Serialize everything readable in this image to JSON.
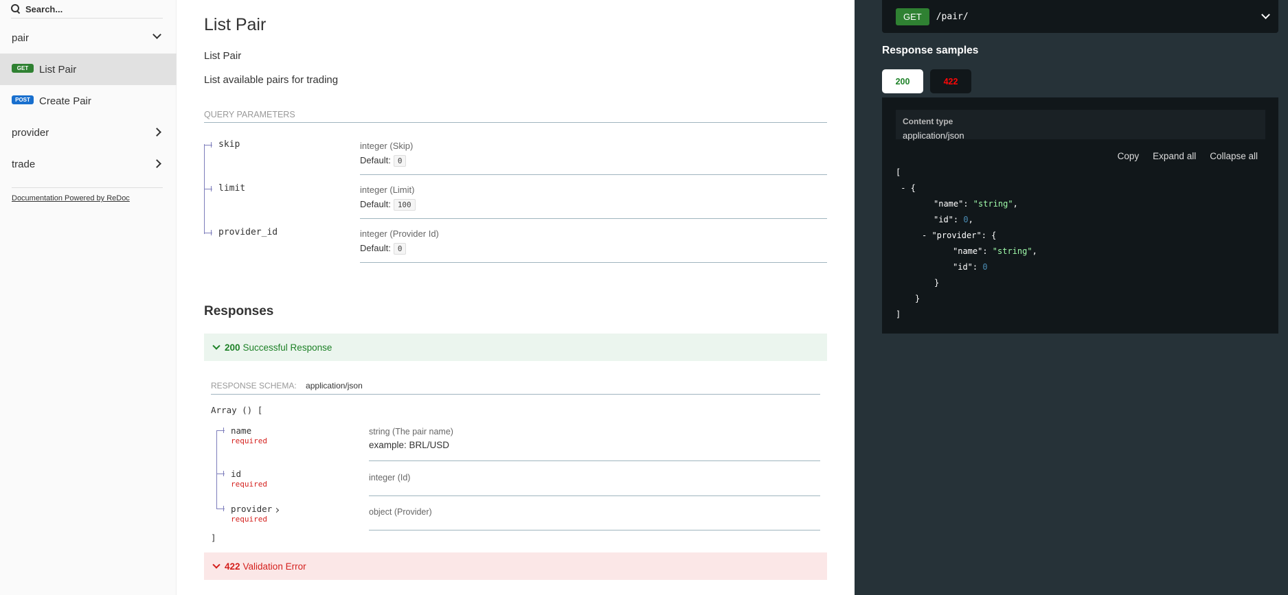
{
  "sidebar": {
    "search_placeholder": "Search...",
    "groups": [
      {
        "label": "pair"
      },
      {
        "label": "provider"
      },
      {
        "label": "trade"
      }
    ],
    "items": [
      {
        "method": "GET",
        "label": "List Pair"
      },
      {
        "method": "POST",
        "label": "Create Pair"
      }
    ],
    "powered_by": "Documentation Powered by ReDoc"
  },
  "main": {
    "title": "List Pair",
    "summary": "List Pair",
    "description": "List available pairs for trading",
    "query_params_title": "QUERY PARAMETERS",
    "params": [
      {
        "name": "skip",
        "type": "integer (Skip)",
        "default_label": "Default:",
        "default": "0"
      },
      {
        "name": "limit",
        "type": "integer (Limit)",
        "default_label": "Default:",
        "default": "100"
      },
      {
        "name": "provider_id",
        "type": "integer (Provider Id)",
        "default_label": "Default:",
        "default": "0"
      }
    ],
    "responses_title": "Responses",
    "responses": [
      {
        "code": "200",
        "label": "Successful Response",
        "color": "#1d8127"
      },
      {
        "code": "422",
        "label": "Validation Error",
        "color": "#d41f1c"
      }
    ],
    "schema": {
      "label": "RESPONSE SCHEMA:",
      "content_type": "application/json",
      "array_open": "Array () [",
      "array_close": "]",
      "fields": [
        {
          "name": "name",
          "required": "required",
          "type": "string (The pair name)",
          "example": "example: BRL/USD"
        },
        {
          "name": "id",
          "required": "required",
          "type": "integer (Id)"
        },
        {
          "name": "provider",
          "required": "required",
          "type": "object (Provider)"
        }
      ]
    }
  },
  "right": {
    "endpoint": {
      "method": "GET",
      "path": "/pair/"
    },
    "samples_title": "Response samples",
    "tabs": [
      "200",
      "422"
    ],
    "content_type_label": "Content type",
    "content_type_value": "application/json",
    "actions": [
      "Copy",
      "Expand all",
      "Collapse all"
    ]
  },
  "colors": {
    "get": "#2f8132",
    "post": "#186fce",
    "right_bg": "#263238",
    "code_bg": "#11171a"
  }
}
